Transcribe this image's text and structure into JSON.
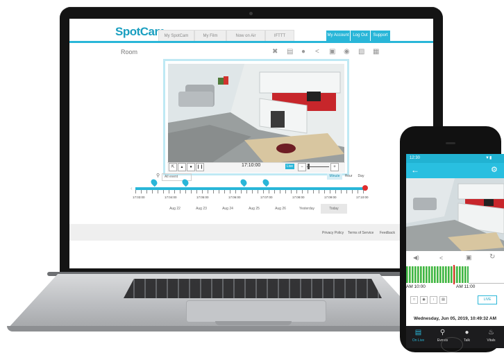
{
  "app": {
    "logo": "SpotCam",
    "brand_color": "#29b6d8",
    "nav_tabs": [
      "My SpotCam",
      "My Film",
      "Now on Air",
      "IFTTT"
    ],
    "account_links": [
      "My Account",
      "Log Out",
      "Support"
    ]
  },
  "camera": {
    "name": "Room",
    "toolbar_icons": [
      "crop-icon",
      "film-icon",
      "microphone-icon",
      "share-icon",
      "snapshot-icon",
      "eye-icon",
      "trash-icon",
      "grid-icon"
    ]
  },
  "player": {
    "time": "17:10:00",
    "live_label": "Live",
    "controls": [
      "fullscreen-icon",
      "volume-icon",
      "talk-icon",
      "pause-icon"
    ]
  },
  "timeline": {
    "event_filter": "All event",
    "zoom_options": [
      "Minute",
      "Hour",
      "Day"
    ],
    "selected_zoom": "Minute",
    "ticks": [
      "17:03:00",
      "17:04:00",
      "17:05:00",
      "17:06:00",
      "17:07:00",
      "17:08:00",
      "17:09:00",
      "17:10:00"
    ],
    "days": [
      "Aug 22",
      "Aug 23",
      "Aug 24",
      "Aug 25",
      "Aug 26",
      "Yesterday",
      "Today"
    ],
    "selected_day": "Today"
  },
  "footer": {
    "links": [
      "Privacy Policy",
      "Terms of Service",
      "Feedback"
    ]
  },
  "phone": {
    "status_time": "12:30",
    "timeline_start": "AM 10:00",
    "timeline_end": "AM 11:00",
    "live_button": "LIVE",
    "datetime": "Wednesday, Jun 05, 2019, 10:49:32 AM",
    "nav": [
      "On Live",
      "Events",
      "Talk",
      "Vitals"
    ]
  }
}
